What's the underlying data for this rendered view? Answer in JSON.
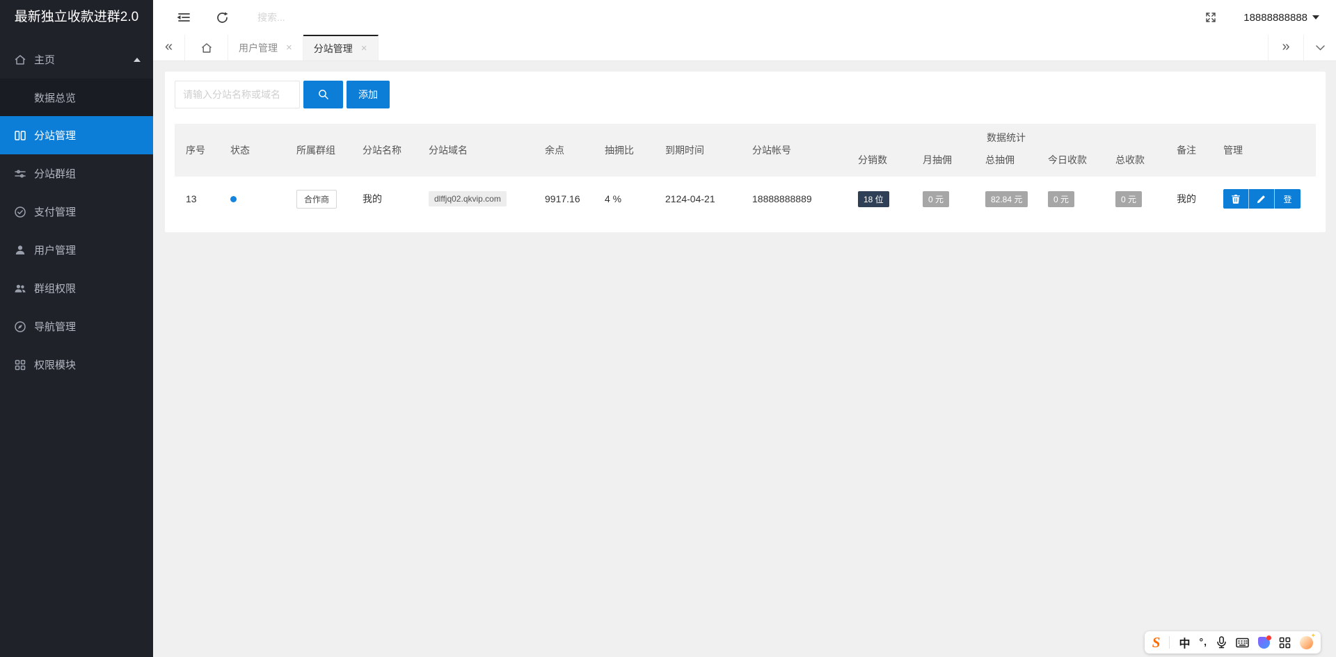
{
  "app_title": "最新独立收款进群2.0",
  "topbar": {
    "search_placeholder": "搜索...",
    "username": "18888888888"
  },
  "tab_bar": {
    "tabs": [
      {
        "label": "用户管理"
      },
      {
        "label": "分站管理"
      }
    ]
  },
  "sidebar": {
    "items": [
      {
        "label": "主页",
        "icon": "home-icon",
        "expanded": true
      },
      {
        "label": "数据总览",
        "submenu": true
      },
      {
        "label": "分站管理",
        "icon": "columns-icon",
        "active": true
      },
      {
        "label": "分站群组",
        "icon": "sliders-icon"
      },
      {
        "label": "支付管理",
        "icon": "shield-check-icon"
      },
      {
        "label": "用户管理",
        "icon": "user-icon"
      },
      {
        "label": "群组权限",
        "icon": "users-icon"
      },
      {
        "label": "导航管理",
        "icon": "compass-icon"
      },
      {
        "label": "权限模块",
        "icon": "blocks-icon"
      }
    ]
  },
  "toolbar": {
    "search_placeholder": "请输入分站名称或域名",
    "add_label": "添加"
  },
  "table": {
    "group_header": "数据统计",
    "columns": [
      "序号",
      "状态",
      "所属群组",
      "分站名称",
      "分站域名",
      "余点",
      "抽拥比",
      "到期时间",
      "分站帐号"
    ],
    "stat_columns": [
      "分销数",
      "月抽佣",
      "总抽佣",
      "今日收款",
      "总收款"
    ],
    "tail_columns": [
      "备注",
      "管理"
    ],
    "row": {
      "no": "13",
      "status_color": "#1385e0",
      "group": "合作商",
      "name": "我的",
      "domain": "dlffjq02.qkvip.com",
      "balance": "9917.16",
      "ratio": "4 %",
      "expire": "2124-04-21",
      "account": "18888888889",
      "distribution": "18 位",
      "month_commission": "0 元",
      "total_commission": "82.84 元",
      "today_income": "0 元",
      "total_income": "0 元",
      "remark": "我的",
      "login_label": "登"
    }
  },
  "ime_bar": {
    "mode": "中",
    "icons": [
      "sogou-logo",
      "chinese-mode",
      "punctuation",
      "microphone",
      "keyboard",
      "skin",
      "toolbox",
      "emoji"
    ]
  },
  "colors": {
    "primary": "#0d7ed8",
    "sidebar_bg": "#20222a",
    "sidebar_active": "#0d7ed8",
    "badge_dark": "#2f4056",
    "badge_gray": "#a6a6a6",
    "status_dot": "#1385e0"
  }
}
